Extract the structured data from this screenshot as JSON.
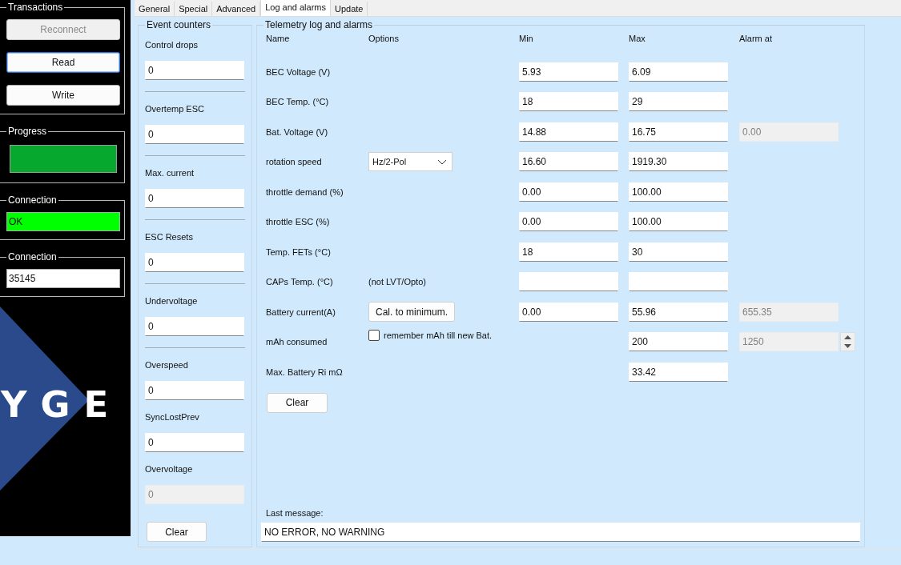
{
  "sidebar": {
    "groups": [
      {
        "title": "Transactions",
        "kind": "buttons",
        "buttons": [
          {
            "label": "Reconnect",
            "disabled": true,
            "focused": false
          },
          {
            "label": "Read",
            "disabled": false,
            "focused": true
          },
          {
            "label": "Write",
            "disabled": false,
            "focused": false
          }
        ]
      },
      {
        "title": "Progress",
        "kind": "progress",
        "level": 1
      },
      {
        "title": "Connection",
        "kind": "status",
        "value": "OK",
        "ok": true
      },
      {
        "title": "Connection",
        "kind": "field",
        "value": "35145"
      }
    ],
    "logo": {
      "text": "YGE"
    }
  },
  "tabs": [
    {
      "label": "General",
      "selected": false
    },
    {
      "label": "Special",
      "selected": false
    },
    {
      "label": "Advanced",
      "selected": false
    },
    {
      "label": "Log and alarms",
      "selected": true
    },
    {
      "label": "Update",
      "selected": false
    }
  ],
  "event_counters": {
    "title": "Event counters",
    "items": [
      {
        "label": "Control drops",
        "value": "0",
        "disabled": false,
        "separator": true
      },
      {
        "label": "Overtemp ESC",
        "value": "0",
        "disabled": false,
        "separator": true
      },
      {
        "label": "Max. current",
        "value": "0",
        "disabled": false,
        "separator": true
      },
      {
        "label": "ESC Resets",
        "value": "0",
        "disabled": false,
        "separator": true
      },
      {
        "label": "Undervoltage",
        "value": "0",
        "disabled": false,
        "separator": true
      },
      {
        "label": "Overspeed",
        "value": "0",
        "disabled": false,
        "separator": false
      },
      {
        "label": "SyncLostPrev",
        "value": "0",
        "disabled": false,
        "separator": false
      },
      {
        "label": "Overvoltage",
        "value": "0",
        "disabled": true,
        "separator": false
      }
    ],
    "clear_button": "Clear"
  },
  "telemetry": {
    "title": "Telemetry log and alarms",
    "columns": [
      "Name",
      "Options",
      "Min",
      "Max",
      "Alarm at"
    ],
    "rows": [
      {
        "name": "BEC Voltage (V)",
        "min": {
          "value": "5.93"
        },
        "max": {
          "value": "6.09"
        }
      },
      {
        "name": "BEC Temp. (°C)",
        "min": {
          "value": "18"
        },
        "max": {
          "value": "29"
        }
      },
      {
        "name": "Bat. Voltage (V)",
        "min": {
          "value": "14.88"
        },
        "max": {
          "value": "16.75"
        },
        "alarm": {
          "value": "0.00",
          "disabled": true,
          "spinner": false
        }
      },
      {
        "name": "rotation speed",
        "option": {
          "kind": "dropdown",
          "value": "Hz/2-Pol"
        },
        "min": {
          "value": "16.60"
        },
        "max": {
          "value": "1919.30"
        }
      },
      {
        "name": "throttle demand (%)",
        "min": {
          "value": "0.00"
        },
        "max": {
          "value": "100.00"
        }
      },
      {
        "name": "throttle ESC (%)",
        "min": {
          "value": "0.00"
        },
        "max": {
          "value": "100.00"
        }
      },
      {
        "name": "Temp. FETs (°C)",
        "min": {
          "value": "18"
        },
        "max": {
          "value": "30"
        }
      },
      {
        "name": "CAPs Temp. (°C)",
        "option": {
          "kind": "note",
          "text": "(not LVT/Opto)"
        },
        "min": {},
        "max": {}
      },
      {
        "name": "Battery current(A)",
        "option": {
          "kind": "button",
          "label": "Cal. to minimum."
        },
        "min": {
          "value": "0.00"
        },
        "max": {
          "value": "55.96"
        },
        "alarm": {
          "value": "655.35",
          "disabled": true,
          "spinner": false
        }
      },
      {
        "name": "mAh consumed",
        "option": {
          "kind": "checkbox",
          "label": "remember mAh till new Bat.",
          "checked": false
        },
        "max": {
          "value": "200"
        },
        "alarm": {
          "value": "1250",
          "disabled": true,
          "spinner": true
        }
      },
      {
        "name": "Max. Battery Ri mΩ",
        "max": {
          "value": "33.42"
        }
      }
    ],
    "clear_button": "Clear",
    "last_message": {
      "label": "Last message:",
      "value": "NO ERROR, NO WARNING"
    }
  }
}
